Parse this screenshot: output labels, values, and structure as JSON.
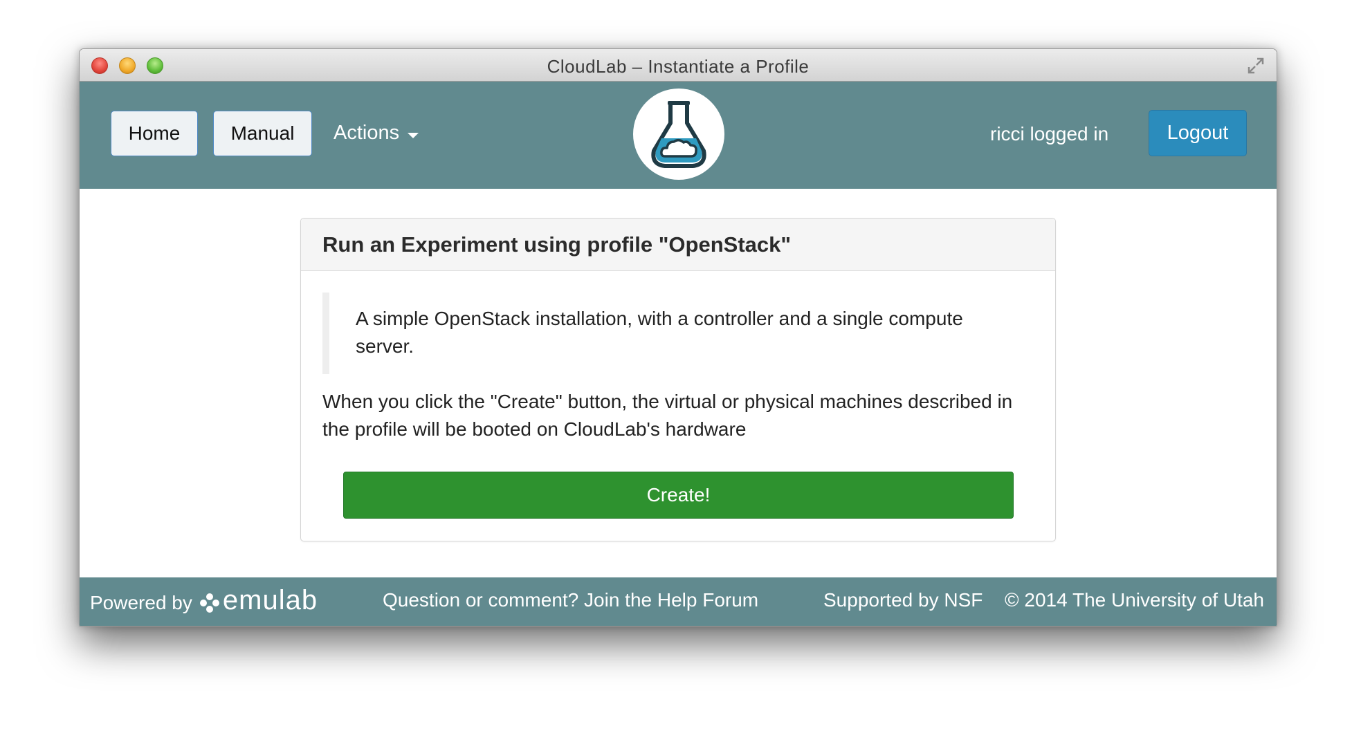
{
  "window": {
    "title": "CloudLab – Instantiate a Profile"
  },
  "navbar": {
    "home_label": "Home",
    "manual_label": "Manual",
    "actions_label": "Actions",
    "user_text": "ricci logged in",
    "logout_label": "Logout",
    "logo_icon": "cloudlab-flask-logo-icon"
  },
  "panel": {
    "title": "Run an Experiment using profile \"OpenStack\"",
    "description": "A simple OpenStack installation, with a controller and a single compute server.",
    "instructions": "When you click the \"Create\" button, the virtual or physical machines described in the profile will be booted on CloudLab's hardware",
    "create_label": "Create!"
  },
  "footer": {
    "powered_by": "Powered by",
    "emulab": "emulab",
    "help_link": "Question or comment? Join the Help Forum",
    "supported": "Supported by NSF",
    "copyright": "© 2014 The University of Utah"
  },
  "colors": {
    "nav_bg": "#618a8f",
    "logout_bg": "#2b8cbc",
    "create_bg": "#2e922f"
  }
}
